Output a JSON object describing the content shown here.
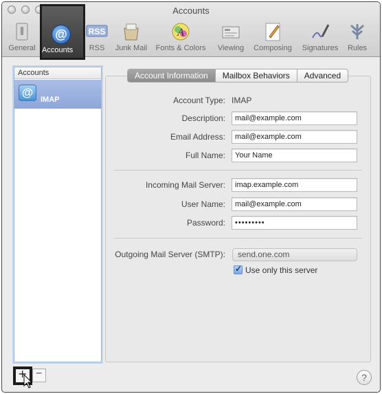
{
  "window": {
    "title": "Accounts"
  },
  "toolbar": {
    "items": [
      {
        "label": "General",
        "icon": "general-switch-icon"
      },
      {
        "label": "Accounts",
        "icon": "at-sign-icon"
      },
      {
        "label": "RSS",
        "icon": "rss-icon"
      },
      {
        "label": "Junk Mail",
        "icon": "junk-mail-icon"
      },
      {
        "label": "Fonts & Colors",
        "icon": "fonts-colors-icon"
      },
      {
        "label": "Viewing",
        "icon": "viewing-icon"
      },
      {
        "label": "Composing",
        "icon": "composing-icon"
      },
      {
        "label": "Signatures",
        "icon": "signatures-icon"
      },
      {
        "label": "Rules",
        "icon": "rules-icon"
      }
    ],
    "selected": "Accounts",
    "rss_badge": "RSS"
  },
  "sidebar": {
    "header": "Accounts",
    "accounts": [
      {
        "name": "IMAP",
        "icon_glyph": "@"
      }
    ]
  },
  "tabs": [
    "Account Information",
    "Mailbox Behaviors",
    "Advanced"
  ],
  "active_tab": "Account Information",
  "form": {
    "account_type_label": "Account Type:",
    "account_type_value": "IMAP",
    "description_label": "Description:",
    "description_value": "mail@example.com",
    "email_label": "Email Address:",
    "email_value": "mail@example.com",
    "fullname_label": "Full Name:",
    "fullname_value": "Your Name",
    "incoming_label": "Incoming Mail Server:",
    "incoming_value": "imap.example.com",
    "username_label": "User Name:",
    "username_value": "mail@example.com",
    "password_label": "Password:",
    "password_value": "•••••••••",
    "smtp_label": "Outgoing Mail Server (SMTP):",
    "smtp_value": "send.one.com",
    "use_only_label": "Use only this server",
    "use_only_checked": true
  },
  "bottom": {
    "add": "+",
    "remove": "−",
    "help": "?"
  },
  "colors": {
    "selection": "#8fa6d9",
    "accent": "#4a93d6"
  }
}
